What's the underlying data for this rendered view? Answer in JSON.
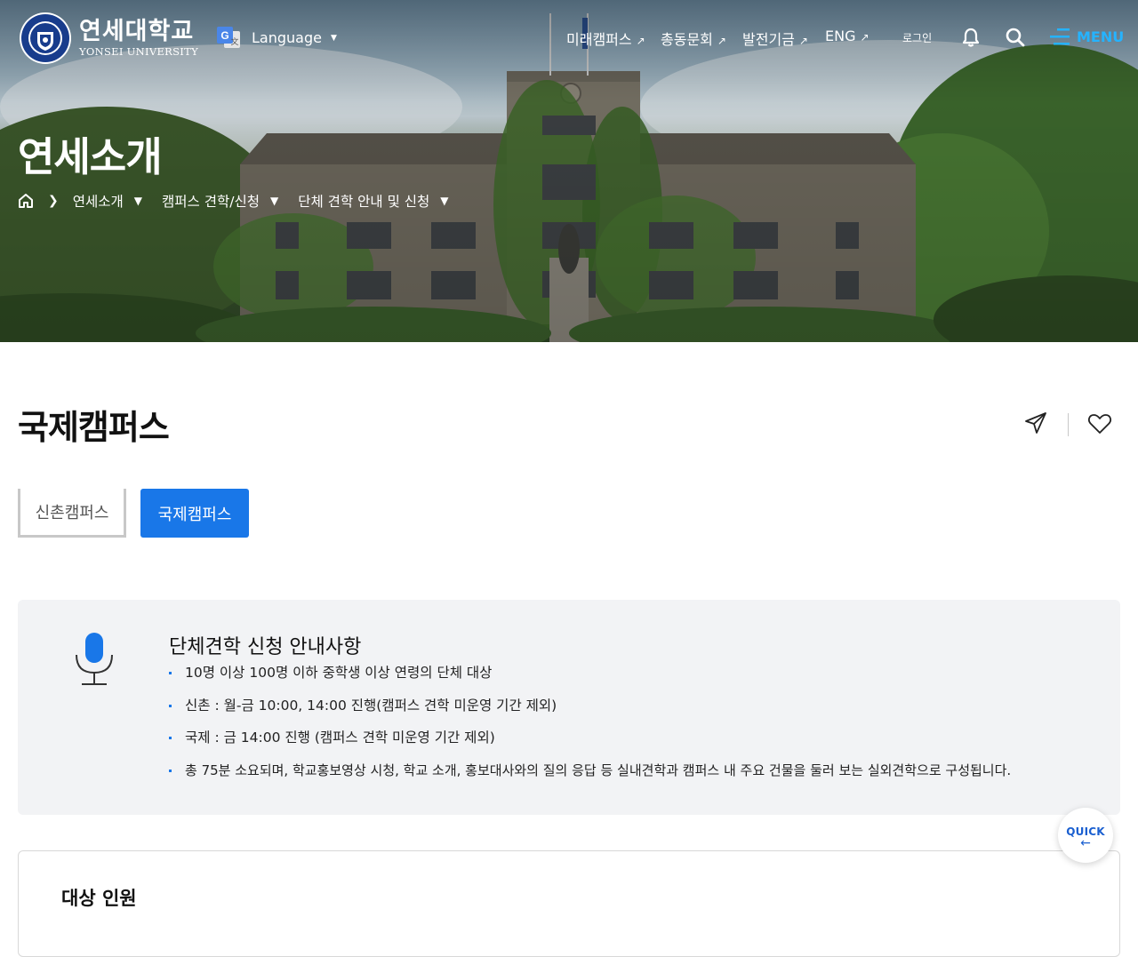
{
  "header": {
    "logo_ko": "연세대학교",
    "logo_en": "YONSEI UNIVERSITY",
    "language_label": "Language",
    "nav": [
      {
        "label": "미래캠퍼스"
      },
      {
        "label": "총동문회"
      },
      {
        "label": "발전기금"
      },
      {
        "label": "ENG"
      }
    ],
    "login_label": "로그인",
    "menu_label": "MENU"
  },
  "hero": {
    "title": "연세소개",
    "breadcrumb": [
      "연세소개",
      "캠퍼스 견학/신청",
      "단체 견학 안내 및 신청"
    ]
  },
  "page": {
    "title": "국제캠퍼스",
    "tabs": [
      {
        "label": "신촌캠퍼스",
        "active": false
      },
      {
        "label": "국제캠퍼스",
        "active": true
      }
    ]
  },
  "notice": {
    "title": "단체견학 신청 안내사항",
    "items": [
      "10명 이상 100명 이하 중학생 이상 연령의 단체 대상",
      "신촌 : 월-금 10:00, 14:00 진행(캠퍼스 견학 미운영 기간 제외)",
      "국제 : 금 14:00 진행 (캠퍼스 견학 미운영 기간 제외)",
      "총 75분 소요되며, 학교홍보영상 시청, 학교 소개, 홍보대사와의 질의 응답 등 실내견학과 캠퍼스 내 주요 건물을 둘러 보는 실외견학으로 구성됩니다."
    ]
  },
  "target_section": {
    "title": "대상 인원"
  },
  "quick": {
    "label": "QUICK",
    "arrow": "←"
  },
  "colors": {
    "accent": "#1977e8",
    "menu": "#25b3ff",
    "notice_bg": "#f2f3f5"
  },
  "icons": [
    "yonsei-emblem-icon",
    "google-translate-icon",
    "bell-icon",
    "search-icon",
    "hamburger-icon",
    "home-icon",
    "share-icon",
    "heart-icon",
    "microphone-icon"
  ]
}
